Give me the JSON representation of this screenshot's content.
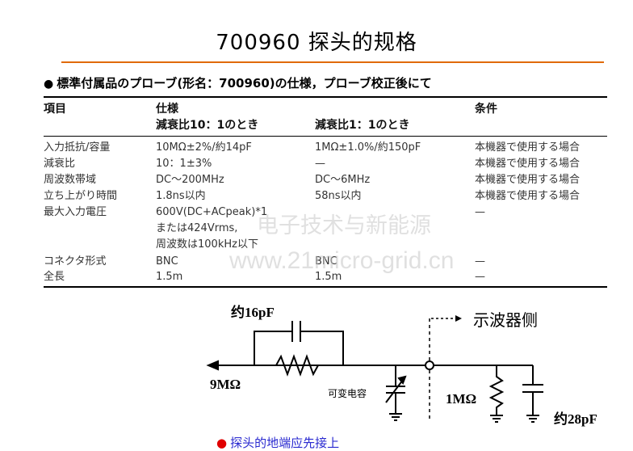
{
  "page_title": "700960 探头的规格",
  "spec": {
    "heading": "標準付属品のプローブ(形名：700960)の仕様，プローブ校正後にて",
    "columns": {
      "item": "項目",
      "spec": "仕様",
      "cond": "条件",
      "ratio10": "減衰比10：1のとき",
      "ratio1": "減衰比1：1のとき"
    },
    "rows": [
      {
        "item": "入力抵抗/容量",
        "r10": [
          "10MΩ±2%/約14pF"
        ],
        "r1": [
          "1MΩ±1.0%/約150pF"
        ],
        "cond": "本機器で使用する場合"
      },
      {
        "item": "減衰比",
        "r10": [
          "10：1±3%"
        ],
        "r1": [
          "—"
        ],
        "cond": "本機器で使用する場合"
      },
      {
        "item": "周波数帯域",
        "r10": [
          "DC～200MHz"
        ],
        "r1": [
          "DC～6MHz"
        ],
        "cond": "本機器で使用する場合"
      },
      {
        "item": "立ち上がり時間",
        "r10": [
          "1.8ns以内"
        ],
        "r1": [
          "58ns以内"
        ],
        "cond": "本機器で使用する場合"
      },
      {
        "item": "最大入力電圧",
        "r10": [
          "600V(DC+ACpeak)*1",
          "または424Vrms,",
          "周波数は100kHz以下"
        ],
        "r1": [
          ""
        ],
        "cond": "—"
      },
      {
        "item": "コネクタ形式",
        "r10": [
          "BNC"
        ],
        "r1": [
          "BNC"
        ],
        "cond": "—"
      },
      {
        "item": "全長",
        "r10": [
          "1.5m"
        ],
        "r1": [
          "1.5m"
        ],
        "cond": "—"
      }
    ]
  },
  "watermark": {
    "line1": "电子技术与新能源",
    "line2": "www.21micro-grid.cn"
  },
  "circuit": {
    "cap_top": "约16pF",
    "resistor_left": "9MΩ",
    "variable_cap": "可变电容",
    "scope_side": "示波器侧",
    "resistor_right": "1MΩ",
    "cap_right": "约28pF"
  },
  "note": "探头的地端应先接上",
  "colors": {
    "title_rule": "#e06a08",
    "note_text": "#2a2ad0",
    "note_bullet": "#e00000"
  }
}
